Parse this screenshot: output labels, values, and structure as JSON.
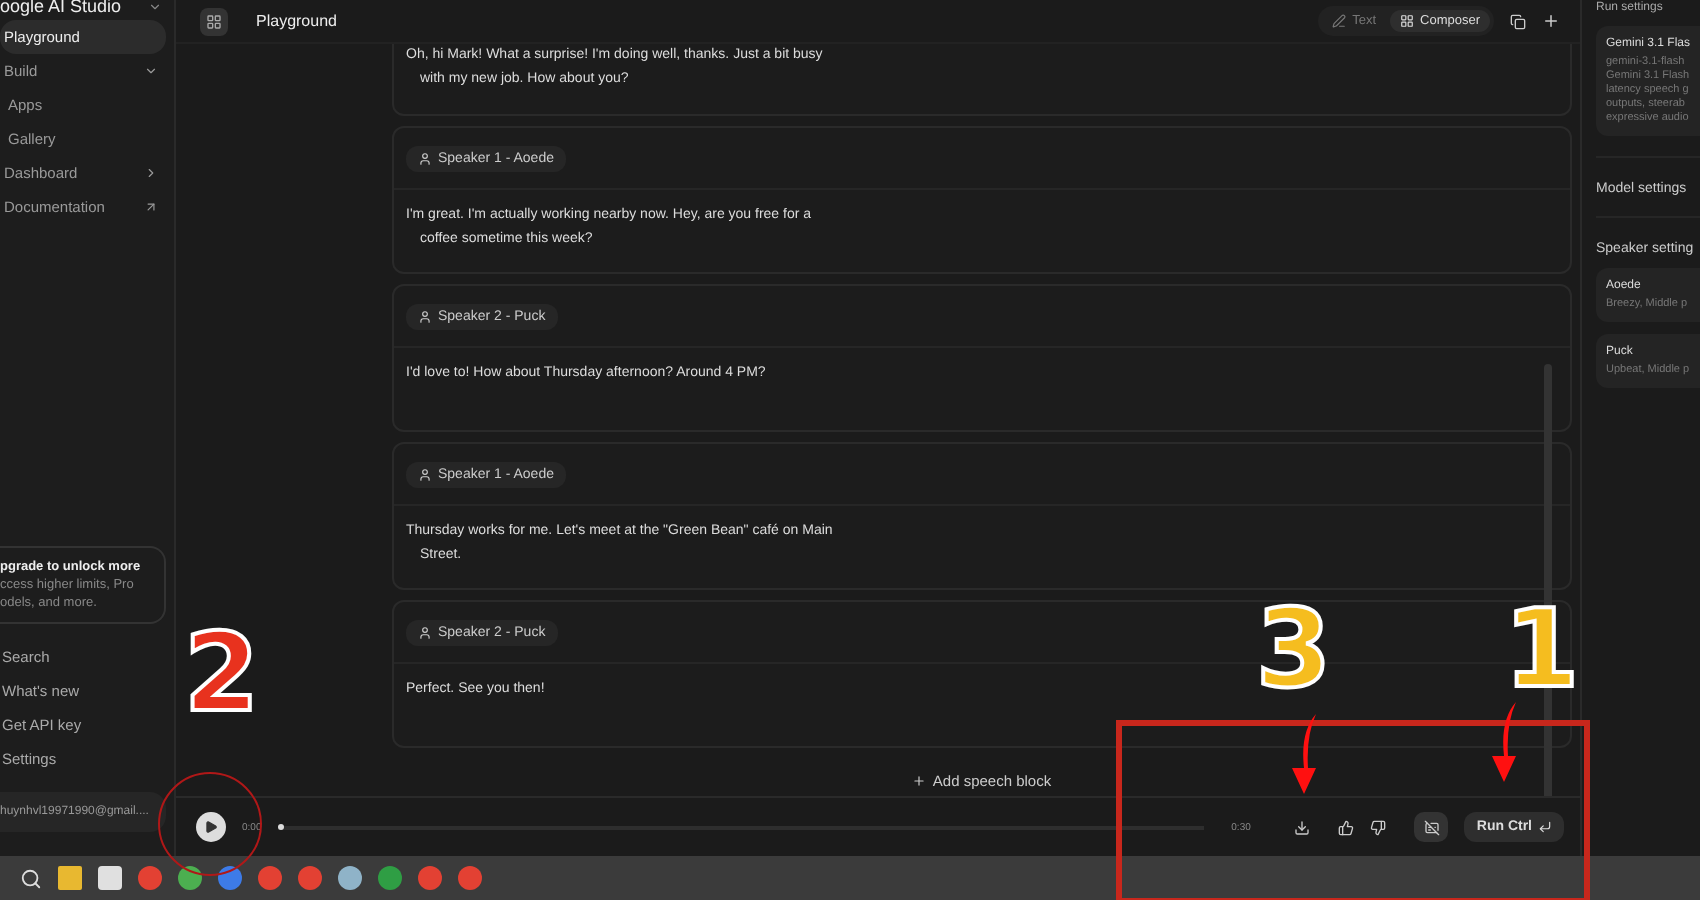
{
  "sidebar": {
    "brand": "oogle AI Studio",
    "items": [
      {
        "label": "Playground",
        "selected": true,
        "kind": "plain"
      },
      {
        "label": "Build",
        "selected": false,
        "kind": "expand"
      },
      {
        "label": "Apps",
        "selected": false,
        "kind": "sub"
      },
      {
        "label": "Gallery",
        "selected": false,
        "kind": "sub"
      },
      {
        "label": "Dashboard",
        "selected": false,
        "kind": "more"
      },
      {
        "label": "Documentation",
        "selected": false,
        "kind": "external"
      }
    ],
    "upgrade": {
      "title": "pgrade to unlock more",
      "lines": [
        "ccess higher limits, Pro",
        "odels, and more."
      ]
    },
    "bottom_items": [
      "Search",
      "What's new",
      "Get API key",
      "Settings"
    ],
    "account": "huynhvl19971990@gmail...."
  },
  "header": {
    "title": "Playground",
    "tabs": [
      {
        "label": "Text",
        "selected": false
      },
      {
        "label": "Composer",
        "selected": true
      }
    ]
  },
  "blocks": [
    {
      "text": "Oh, hi Mark! What a surprise! I'm doing well, thanks. Just a bit busy\nwith my new job. How about you?"
    },
    {
      "speaker": "Speaker 1 - Aoede",
      "text": "I'm great. I'm actually working nearby now. Hey, are you free for a\ncoffee sometime this week?"
    },
    {
      "speaker": "Speaker 2 - Puck",
      "text": "I'd love to! How about Thursday afternoon? Around 4 PM?"
    },
    {
      "speaker": "Speaker 1 - Aoede",
      "text": "Thursday works for me. Let's meet at the \"Green Bean\" café on Main\nStreet."
    },
    {
      "speaker": "Speaker 2 - Puck",
      "text": "Perfect. See you then!"
    }
  ],
  "add_block": "Add speech block",
  "player": {
    "start": "0:00",
    "end": "0:30",
    "level": 0,
    "run": "Run Ctrl"
  },
  "run_settings": {
    "title": "Run settings",
    "model": {
      "name": "Gemini 3.1 Flas",
      "lines": [
        "gemini-3.1-flash",
        "Gemini 3.1 Flash",
        "latency speech g",
        "outputs, steerab",
        "expressive audio"
      ]
    },
    "model_settings": "Model settings",
    "speaker_settings": "Speaker setting",
    "speakers": [
      {
        "name": "Aoede",
        "desc": "Breezy, Middle p"
      },
      {
        "name": "Puck",
        "desc": "Upbeat, Middle p"
      }
    ]
  },
  "annotations": [
    {
      "text": "2",
      "color": "#e8321e"
    },
    {
      "text": "3",
      "color": "#f5bd1f"
    },
    {
      "text": "1",
      "color": "#f5bd1f"
    }
  ]
}
